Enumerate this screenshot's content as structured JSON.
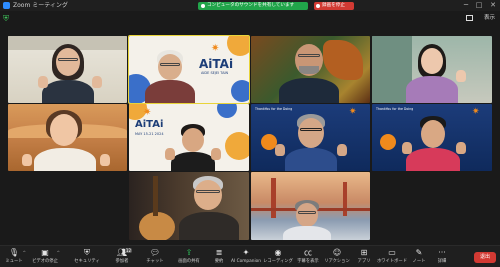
{
  "window": {
    "title": "Zoom ミーティング",
    "controls": [
      "─",
      "□",
      "✕"
    ]
  },
  "banners": {
    "share": "コンピュータのサウンドを共有しています",
    "recording": "録画を停止"
  },
  "top_bar": {
    "view_label": "表示"
  },
  "tiles": {
    "aitai_logo": "AiTAi",
    "expo_line1": "AIDE SEJEI TAIN",
    "expo_line2": "MAY 15-21 2024",
    "bg_logo": "ThankYou for the Doing"
  },
  "toolbar": {
    "items": [
      {
        "label": "ミュート",
        "icon": "microphone-icon"
      },
      {
        "label": "ビデオの停止",
        "icon": "video-camera-icon"
      },
      {
        "label": "セキュリティ",
        "icon": "shield-icon"
      },
      {
        "label": "参加者",
        "icon": "participants-icon",
        "count": "12"
      },
      {
        "label": "チャット",
        "icon": "chat-icon"
      },
      {
        "label": "画面の共有",
        "icon": "share-screen-icon"
      },
      {
        "label": "要約",
        "icon": "summary-icon"
      },
      {
        "label": "AI Companion",
        "icon": "ai-companion-icon"
      },
      {
        "label": "レコーディング",
        "icon": "record-icon"
      },
      {
        "label": "字幕を表示",
        "icon": "captions-icon"
      },
      {
        "label": "リアクション",
        "icon": "reaction-icon"
      },
      {
        "label": "アプリ",
        "icon": "apps-icon"
      },
      {
        "label": "ホワイトボード",
        "icon": "whiteboard-icon"
      },
      {
        "label": "ノート",
        "icon": "notes-icon"
      },
      {
        "label": "詳細",
        "icon": "more-icon"
      }
    ],
    "leave_label": "退出"
  }
}
